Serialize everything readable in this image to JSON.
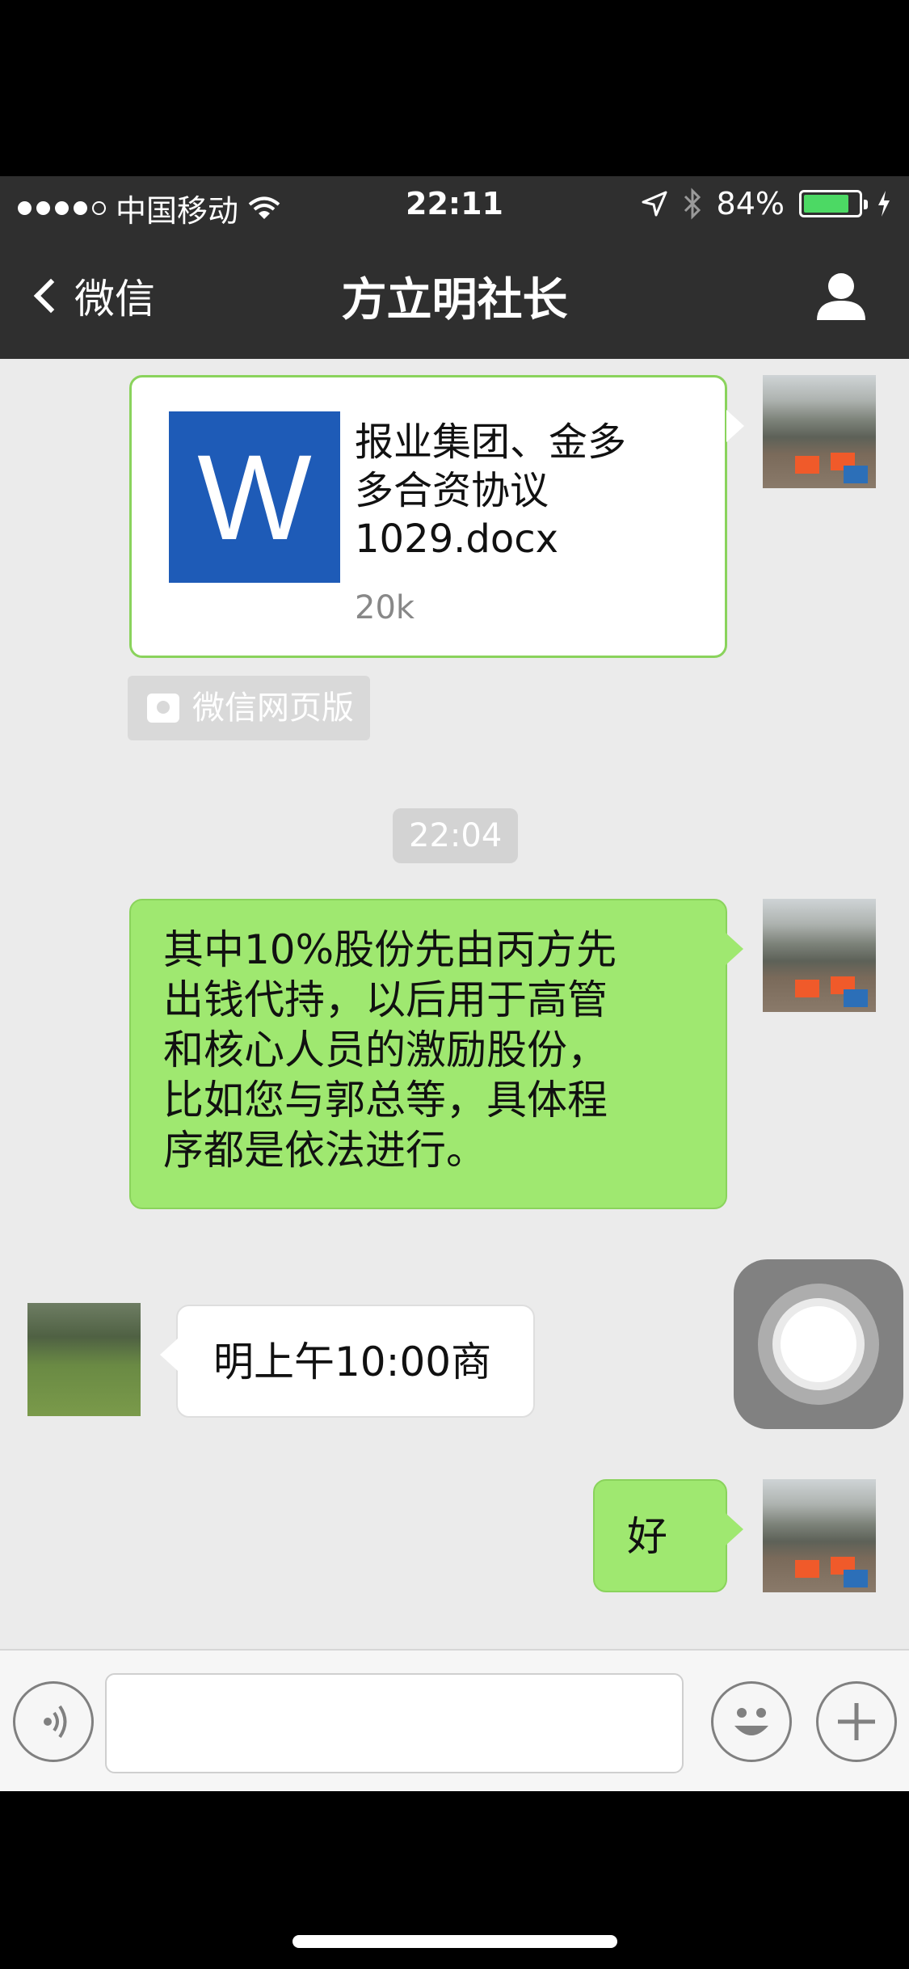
{
  "status_bar": {
    "carrier": "中国移动",
    "time": "22:11",
    "battery_percent": "84%",
    "battery_level": 0.84,
    "icons": [
      "signal-dots-icon",
      "wifi-icon",
      "location-arrow-icon",
      "bluetooth-icon",
      "battery-icon",
      "charging-bolt-icon"
    ]
  },
  "nav": {
    "back_label": "微信",
    "title": "方立明社长",
    "profile_icon": "person-icon"
  },
  "messages": {
    "file": {
      "name_line1": "报业集团、金多",
      "name_line2": "多合资协议",
      "name_line3": "1029.docx",
      "size": "20k",
      "icon_letter": "W",
      "icon_color": "#1e5bb7"
    },
    "source_tag": "微信网页版",
    "timestamp": "22:04",
    "outgoing_text_lines": [
      "其中10%股份先由丙方先",
      "出钱代持，以后用于高管",
      "和核心人员的激励股份，",
      "比如您与郭总等，具体程",
      "序都是依法进行。"
    ],
    "incoming_text": "明上午10:00商",
    "reply_text": "好"
  },
  "input_bar": {
    "voice_icon": "voice-icon",
    "emoji_icon": "emoji-icon",
    "plus_icon": "plus-icon"
  },
  "colors": {
    "nav_bg": "#2f2f2f",
    "chat_bg": "#ebebeb",
    "outgoing_bubble": "#9fe870",
    "incoming_bubble": "#ffffff",
    "battery_green": "#4cd964"
  }
}
